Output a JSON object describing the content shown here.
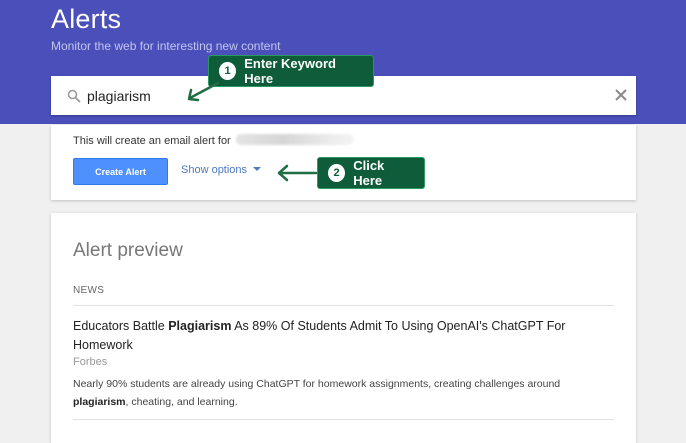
{
  "header": {
    "title": "Alerts",
    "subtitle": "Monitor the web for interesting new content",
    "background": "#4a4fb9"
  },
  "search": {
    "value": "plagiarism",
    "icon": "search-icon",
    "clear_icon": "close-icon"
  },
  "options_card": {
    "email_note": "This will create an email alert for",
    "create_button": "Create Alert",
    "show_options": "Show options",
    "button_color": "#4d90fe",
    "link_color": "#4d78c4"
  },
  "preview": {
    "title": "Alert preview",
    "section_label": "NEWS",
    "article": {
      "title_before": "Educators Battle ",
      "title_bold": "Plagiarism",
      "title_after": " As 89% Of Students Admit To Using OpenAI's ChatGPT For Homework",
      "source": "Forbes",
      "snippet_before": "Nearly 90% students are already using ChatGPT for homework assignments, creating challenges around ",
      "snippet_bold": "plagiarism",
      "snippet_after": ", cheating, and learning."
    }
  },
  "annotations": {
    "callout1": {
      "step": "1",
      "text": "Enter Keyword Here"
    },
    "callout2": {
      "step": "2",
      "text": "Click Here"
    },
    "color": "#0e5c3a"
  }
}
